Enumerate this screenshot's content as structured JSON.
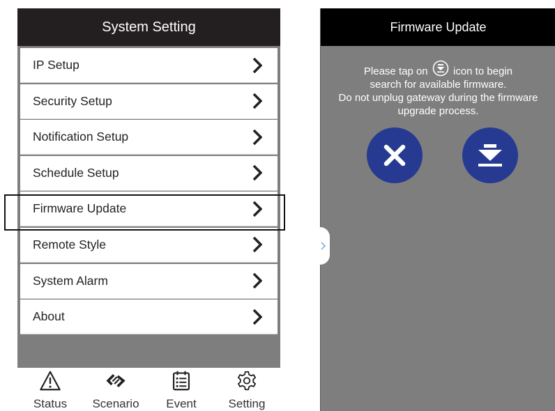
{
  "left": {
    "header": {
      "title": "System Setting"
    },
    "menu": [
      {
        "label": "IP Setup"
      },
      {
        "label": "Security Setup"
      },
      {
        "label": "Notification Setup"
      },
      {
        "label": "Schedule Setup"
      },
      {
        "label": "Firmware Update"
      },
      {
        "label": "Remote Style"
      },
      {
        "label": "System Alarm"
      },
      {
        "label": "About"
      }
    ],
    "tabs": [
      {
        "label": "Status",
        "icon": "warning-icon"
      },
      {
        "label": "Scenario",
        "icon": "scenario-icon"
      },
      {
        "label": "Event",
        "icon": "calendar-icon"
      },
      {
        "label": "Setting",
        "icon": "gear-icon"
      }
    ]
  },
  "right": {
    "header": {
      "title": "Firmware Update"
    },
    "message": {
      "line1_pre": "Please tap on",
      "line1_post": "icon to begin",
      "line2": "search for available firmware.",
      "line3": "Do not unplug gateway during the firmware",
      "line4": "upgrade process."
    },
    "buttons": [
      {
        "icon": "close-icon"
      },
      {
        "icon": "download-icon"
      }
    ]
  },
  "colors": {
    "panel_bg": "#7e7e7e",
    "left_header_bg": "#231f20",
    "right_header_bg": "#000000",
    "button_blue": "#263a91",
    "chevron": "#222222"
  }
}
